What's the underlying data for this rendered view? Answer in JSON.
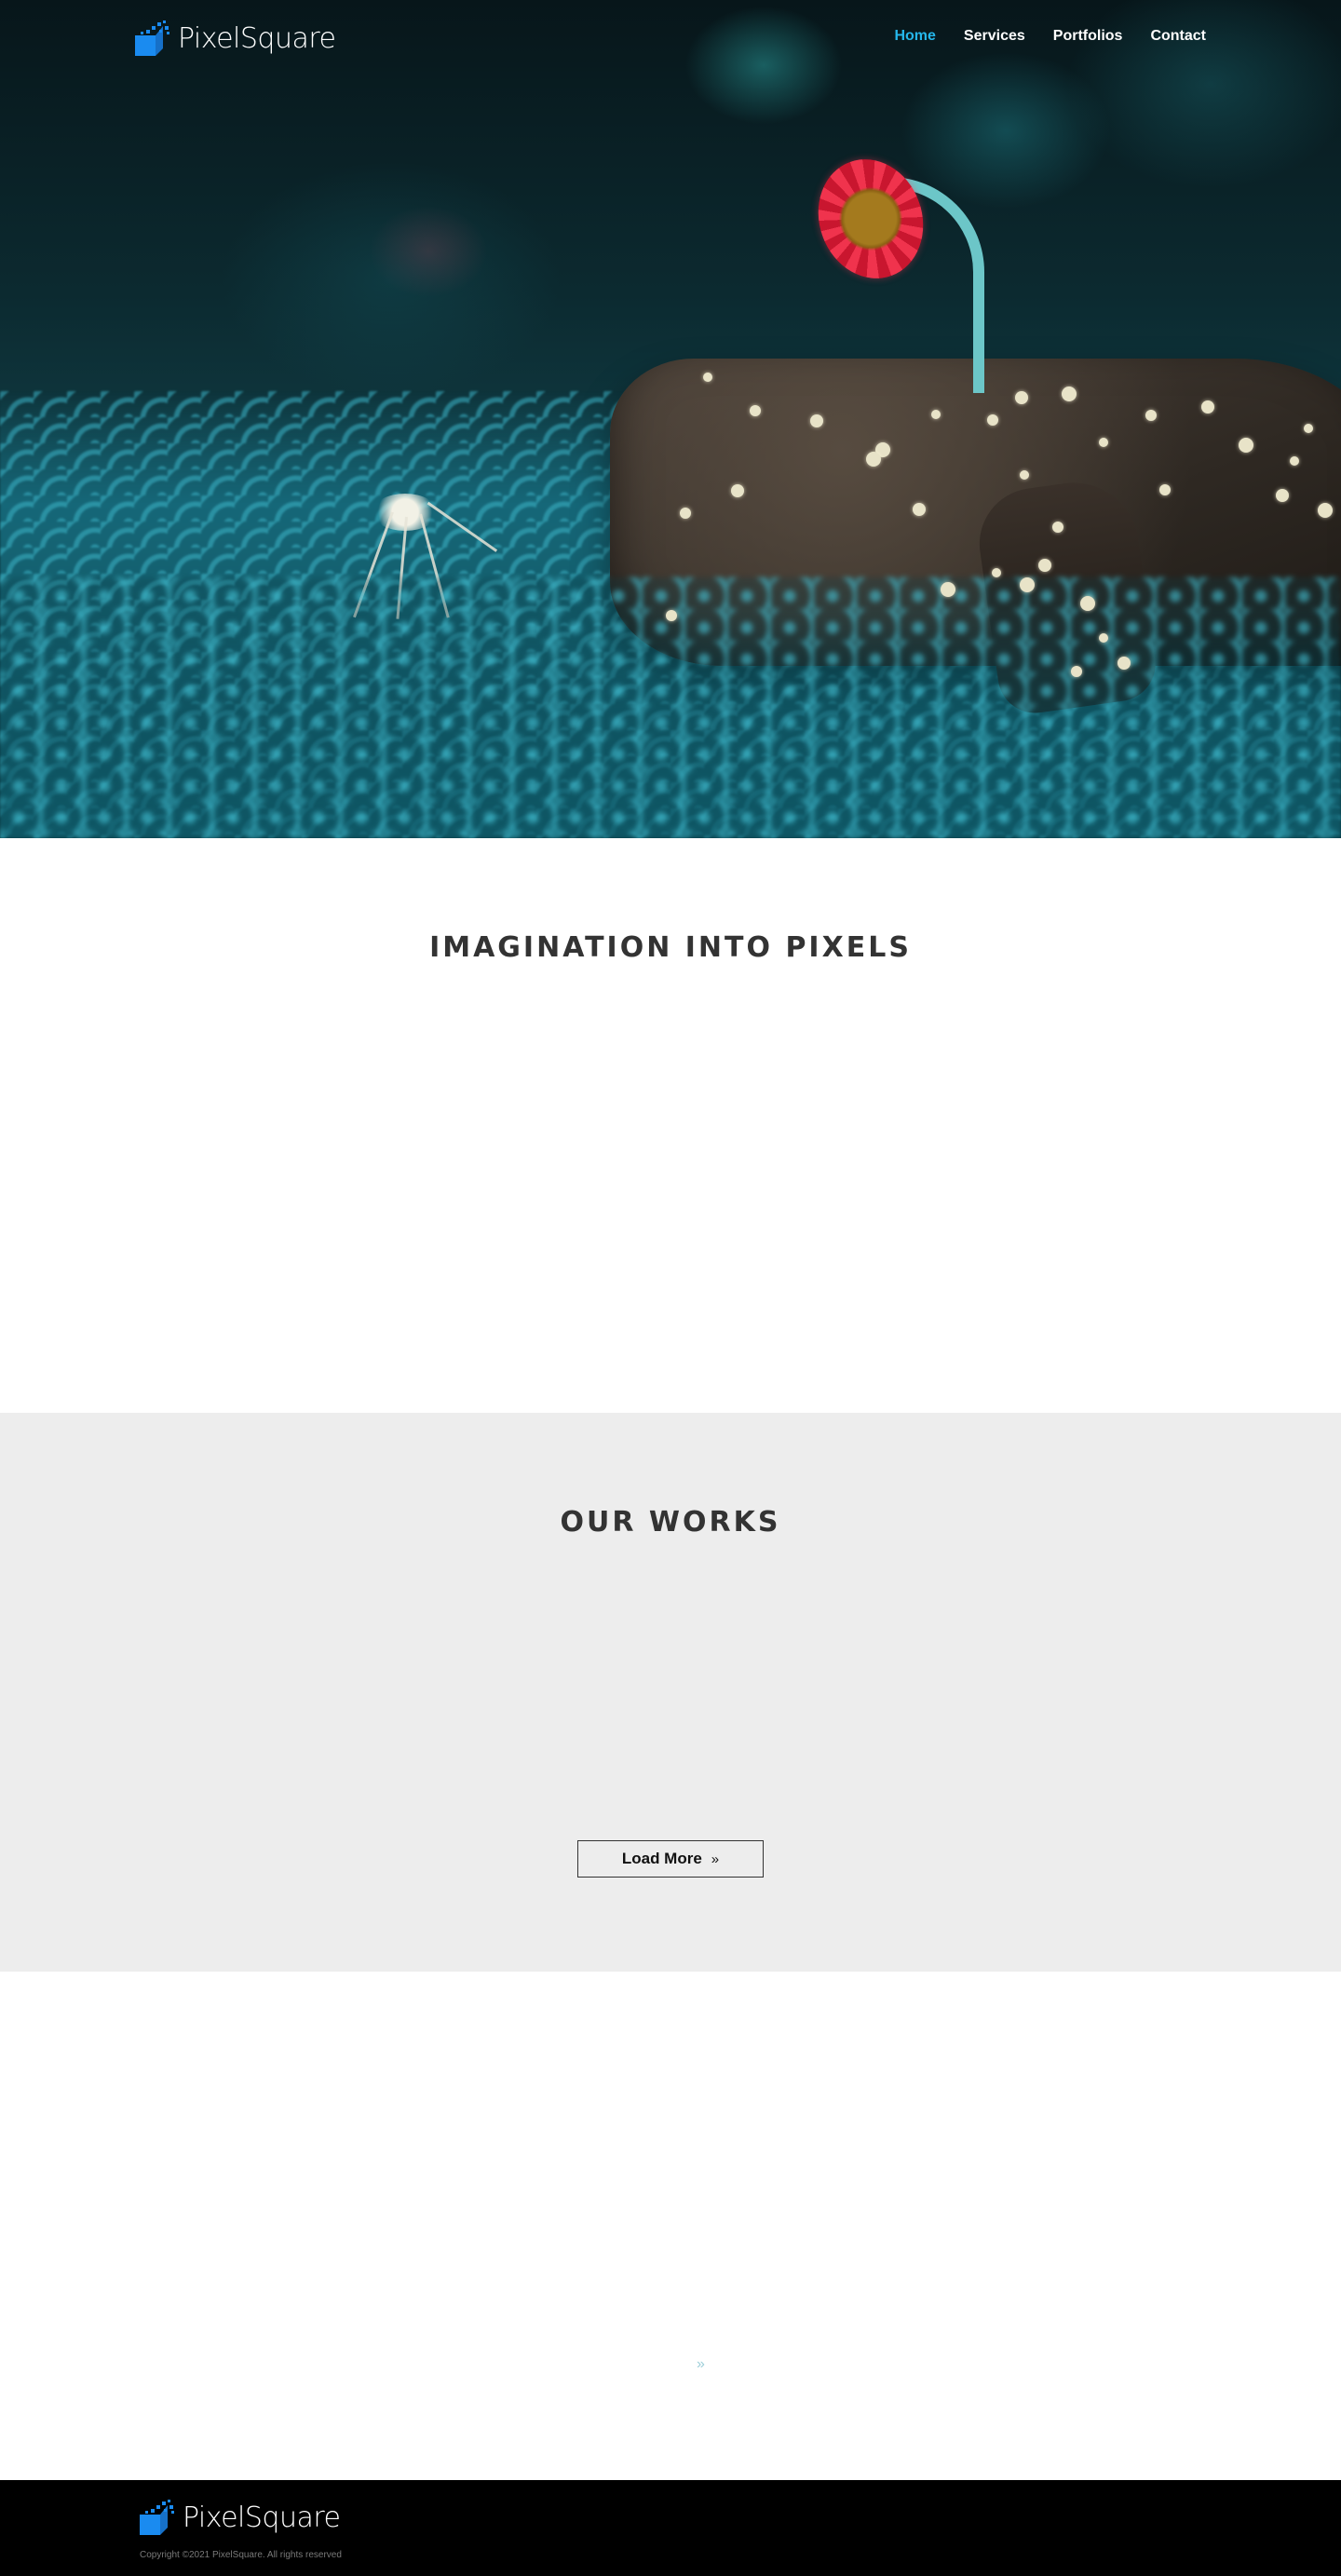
{
  "brand": {
    "name": "PixelSquare",
    "logo_icon": "pixel-square-logo-icon",
    "accent_color": "#1a8bf0"
  },
  "nav": {
    "items": [
      {
        "label": "Home",
        "active": true
      },
      {
        "label": "Services",
        "active": false
      },
      {
        "label": "Portfolios",
        "active": false
      },
      {
        "label": "Contact",
        "active": false
      }
    ],
    "active_color": "#25b6ea"
  },
  "hero": {
    "image": "fantasy-flower-meadow-hero-image"
  },
  "intro": {
    "title": "IMAGINATION INTO PIXELS"
  },
  "works": {
    "title": "OUR WORKS",
    "load_more_label": "Load More",
    "load_more_icon": "double-chevron-right-icon"
  },
  "blank_section": {
    "icon": "double-chevron-right-icon"
  },
  "footer": {
    "brand": "PixelSquare",
    "copyright": "Copyright ©2021 PixelSquare. All rights reserved"
  }
}
